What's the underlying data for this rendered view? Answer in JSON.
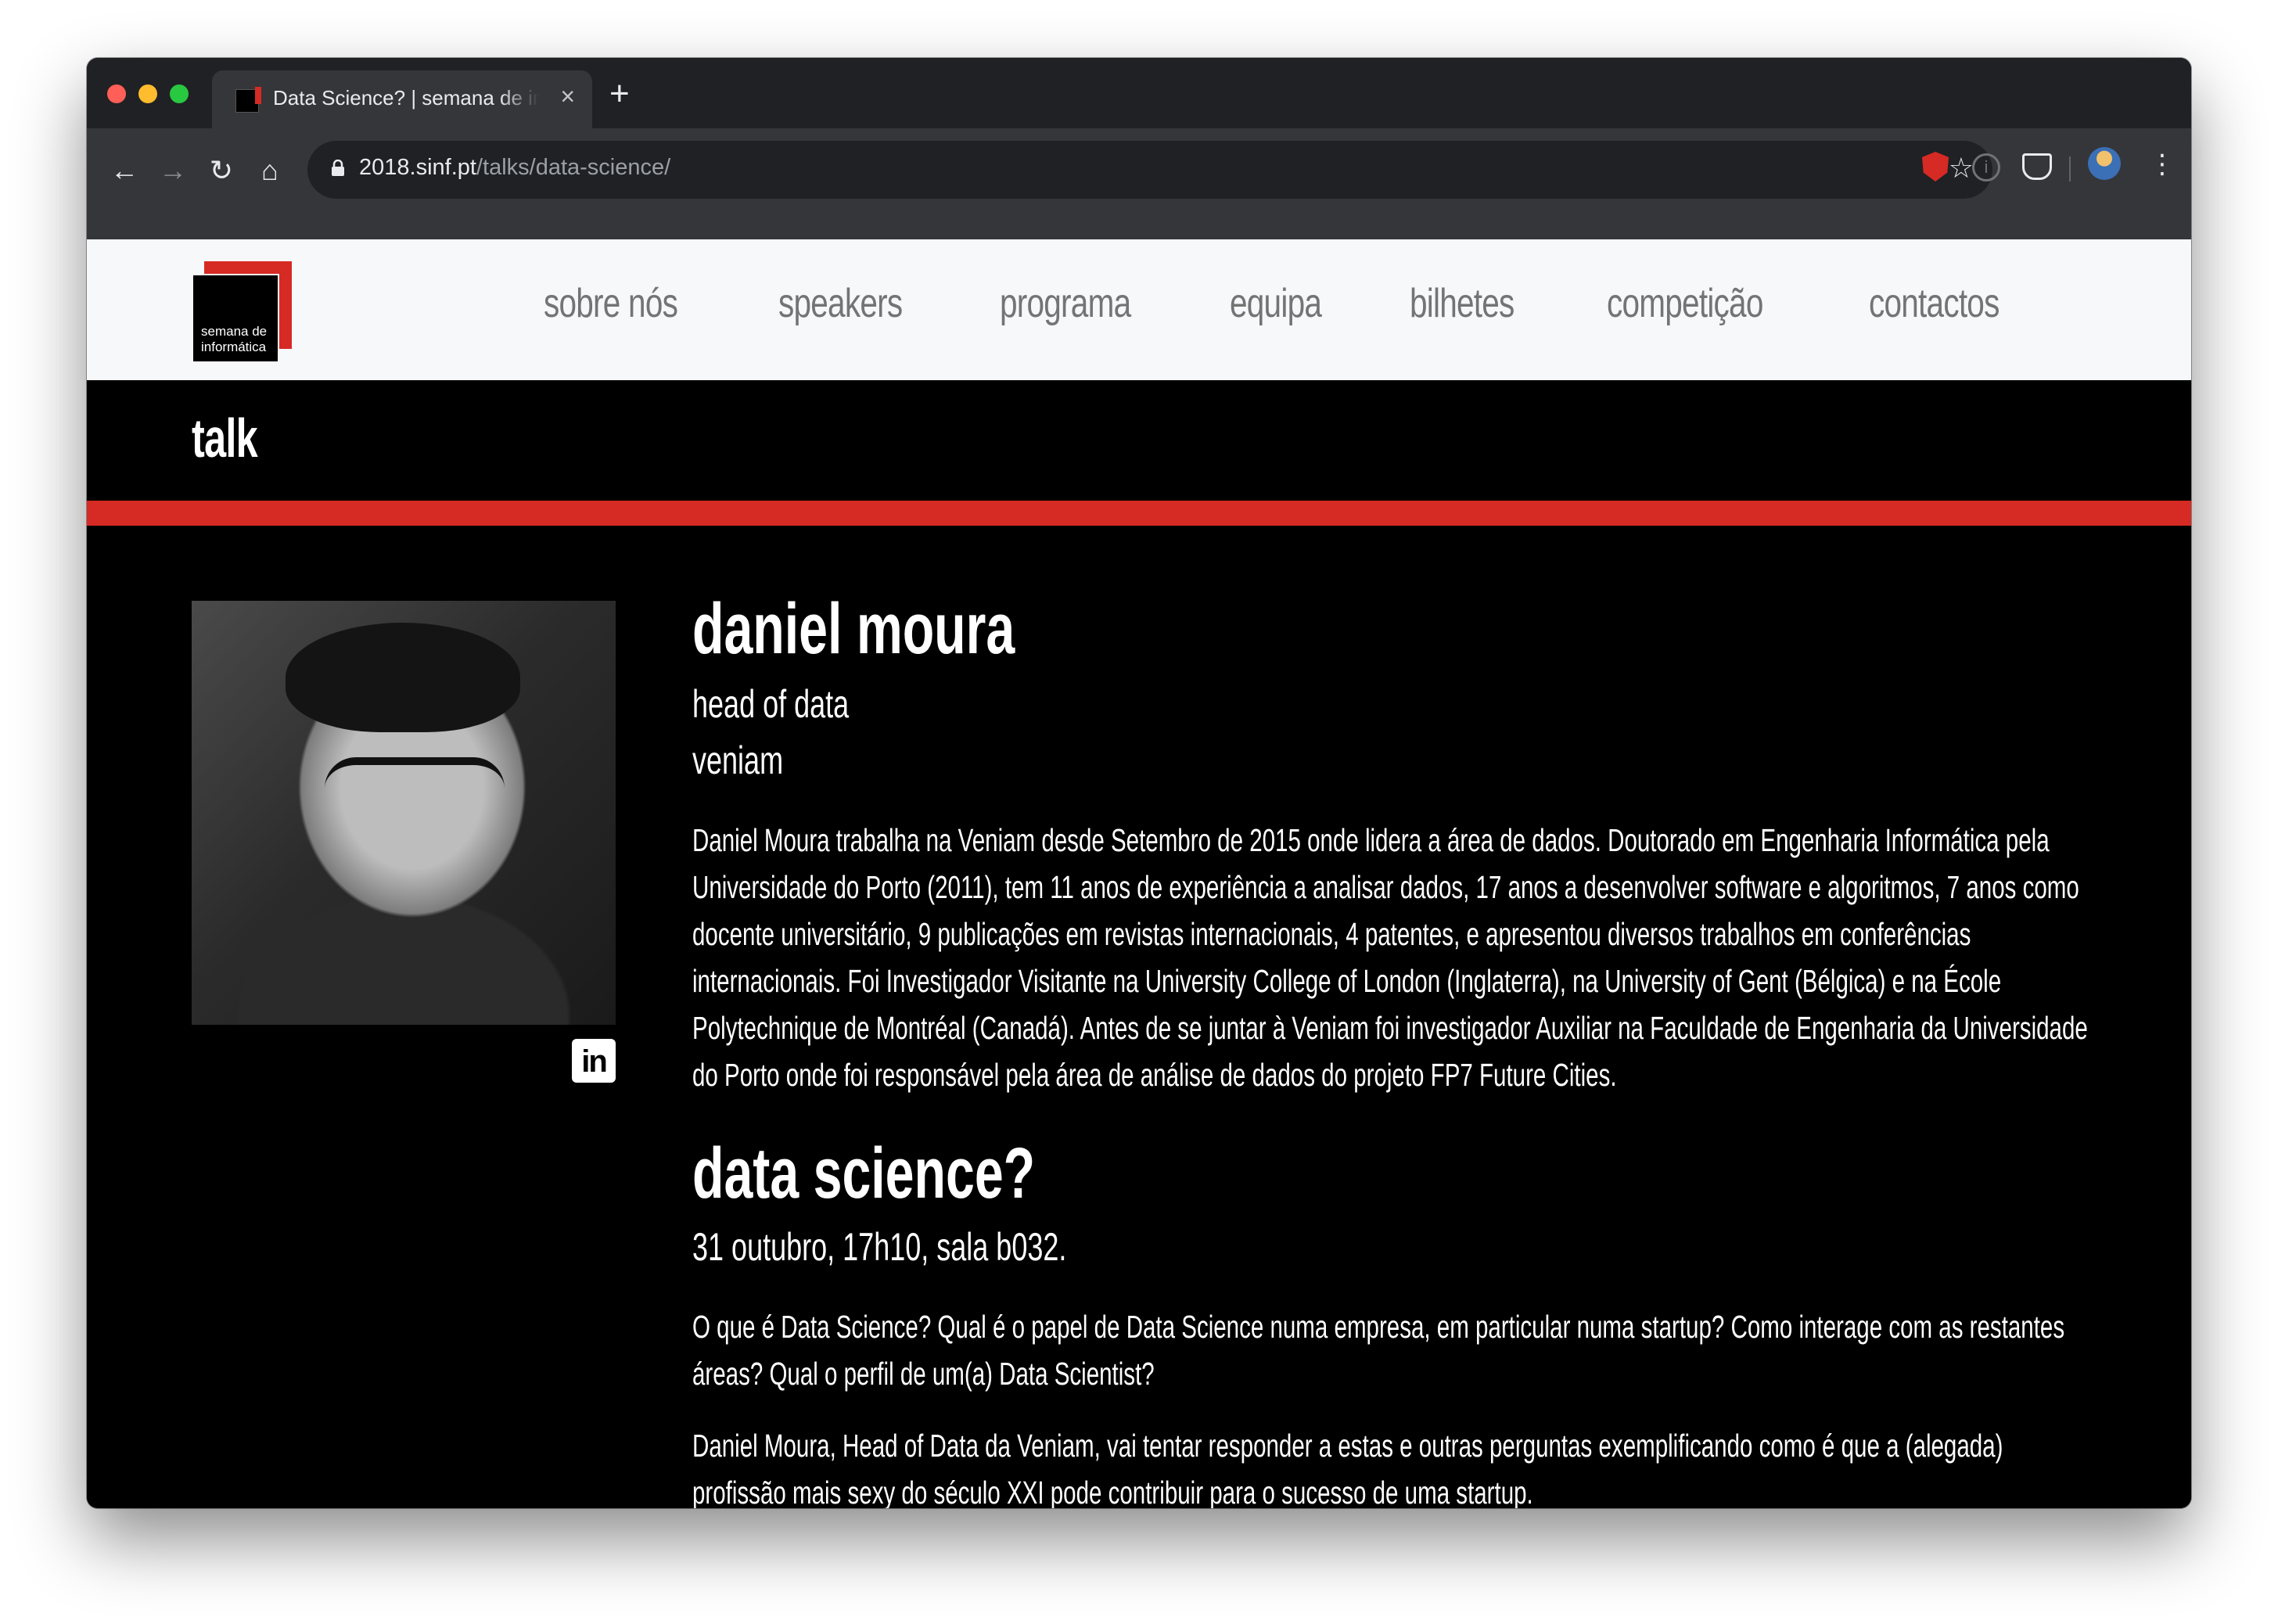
{
  "browser": {
    "tab_title": "Data Science? | semana de informática",
    "tab_close": "×",
    "new_tab": "+",
    "url_host": "2018.sinf.pt",
    "url_path": "/talks/data-science/",
    "back": "←",
    "forward": "→",
    "reload": "↻",
    "home": "⌂",
    "star": "☆",
    "info": "i",
    "menu": "⋮"
  },
  "site": {
    "logo_line1": "semana de",
    "logo_line2": "informática",
    "nav": [
      "sobre nós",
      "speakers",
      "programa",
      "equipa",
      "bilhetes",
      "competição",
      "contactos"
    ]
  },
  "banner": {
    "title": "talk"
  },
  "speaker": {
    "name": "daniel moura",
    "role": "head of data",
    "company": "veniam",
    "bio": "Daniel Moura trabalha na Veniam desde Setembro de 2015 onde lidera a área de dados. Doutorado em Engenharia Informática pela Universidade do Porto (2011), tem 11 anos de experiência a analisar dados, 17 anos a desenvolver software e algoritmos, 7 anos como docente universitário, 9 publicações em revistas internacionais, 4 patentes, e apresentou diversos trabalhos em conferências internacionais. Foi Investigador Visitante na University College of London (Inglaterra), na University of Gent (Bélgica) e na École Polytechnique de Montréal (Canadá). Antes de se juntar à Veniam foi investigador Auxiliar na Faculdade de Engenharia da Universidade do Porto onde foi responsável pela área de análise de dados do projeto FP7 Future Cities.",
    "linkedin": "in"
  },
  "talk": {
    "title": "data science?",
    "meta": "31 outubro, 17h10, sala b032.",
    "paragraph1": "O que é Data Science? Qual é o papel de Data Science numa empresa, em particular numa startup? Como interage com as restantes áreas? Qual o perfil de um(a) Data Scientist?",
    "paragraph2": "Daniel Moura, Head of Data da Veniam, vai tentar responder a estas e outras perguntas exemplificando como é que a (alegada) profissão mais sexy do século XXI pode contribuir para o sucesso de uma startup."
  },
  "colors": {
    "accent_red": "#d62a24",
    "nav_gray": "#747474",
    "header_bg": "#f7f8fa",
    "page_bg": "#000000"
  }
}
